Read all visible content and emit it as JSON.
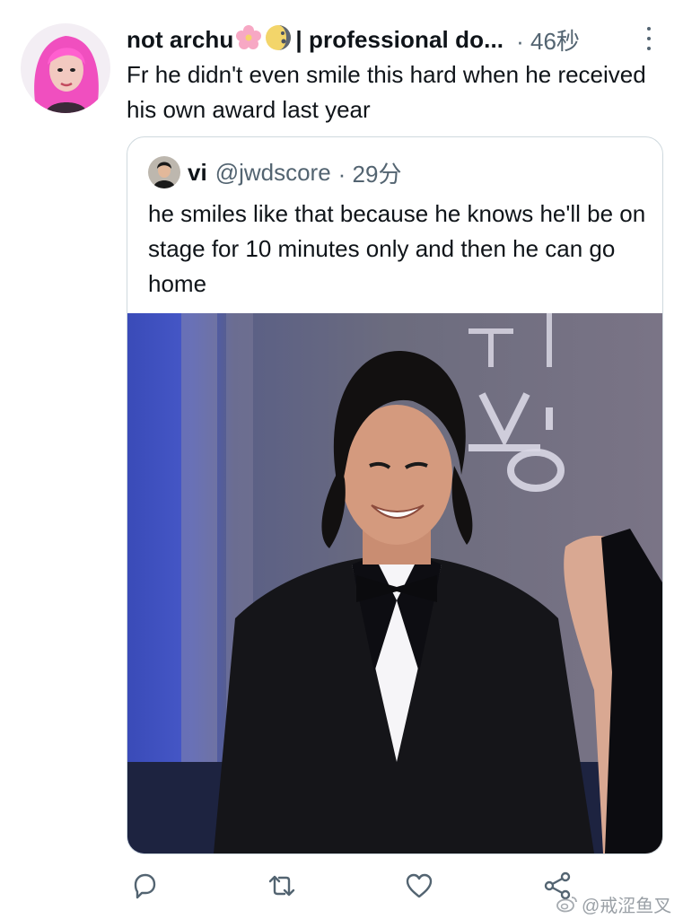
{
  "tweet": {
    "author_name": "not archu",
    "author_name_emoji": [
      "cherry-blossom",
      "moon"
    ],
    "author_name_rest": "| professional do...",
    "time": "· 46秒",
    "text": "Fr he didn't even smile this hard when he received his own award last year"
  },
  "quote": {
    "author_name": "vi",
    "author_handle": "@jwdscore",
    "time": "· 29分",
    "text": "he smiles like that because he knows he'll be on stage for 10 minutes only and then he can go home",
    "photo": "man in black tuxedo smiling on stage"
  },
  "actions": [
    "reply-icon",
    "retweet-icon",
    "like-icon",
    "share-icon"
  ],
  "watermark": "@戒涩鱼叉",
  "colors": {
    "text_primary": "#0f1419",
    "text_secondary": "#536471",
    "border": "#cfd9de"
  }
}
